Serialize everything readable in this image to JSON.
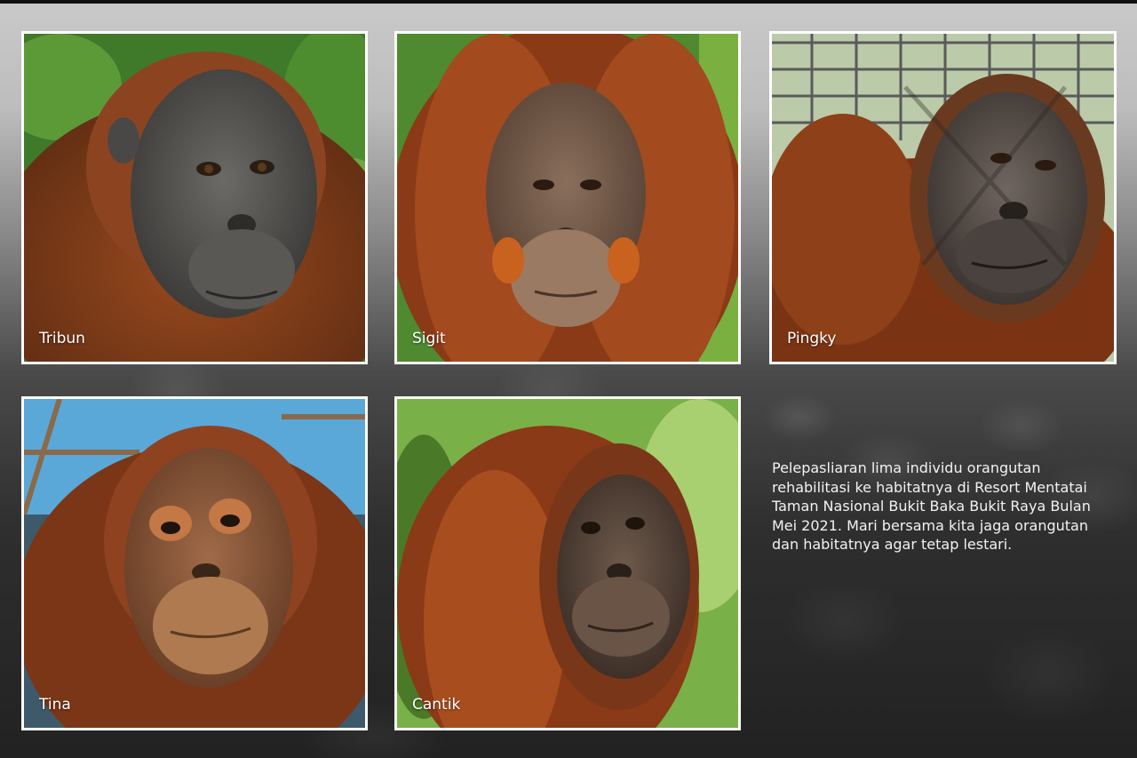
{
  "gallery": {
    "photos": [
      {
        "name": "Tribun",
        "subject": "orangutan portrait",
        "background": "green foliage"
      },
      {
        "name": "Sigit",
        "subject": "orangutan portrait",
        "background": "green foliage"
      },
      {
        "name": "Pingky",
        "subject": "orangutan portrait",
        "background": "metal cage enclosure"
      },
      {
        "name": "Tina",
        "subject": "orangutan portrait",
        "background": "blue sky and wooden platform"
      },
      {
        "name": "Cantik",
        "subject": "orangutan portrait",
        "background": "green foliage"
      }
    ]
  },
  "caption": {
    "text": "Pelepasliaran lima individu orangutan rehabilitasi ke habitatnya di Resort Mentatai Taman Nasional Bukit Baka Bukit Raya Bulan Mei 2021. Mari bersama kita jaga orangutan dan habitatnya agar tetap lestari."
  },
  "colors": {
    "frame": "#ffffff",
    "fur": "#8a3f1a",
    "face": "#4a4a48",
    "foliage": "#3f7a2a"
  }
}
